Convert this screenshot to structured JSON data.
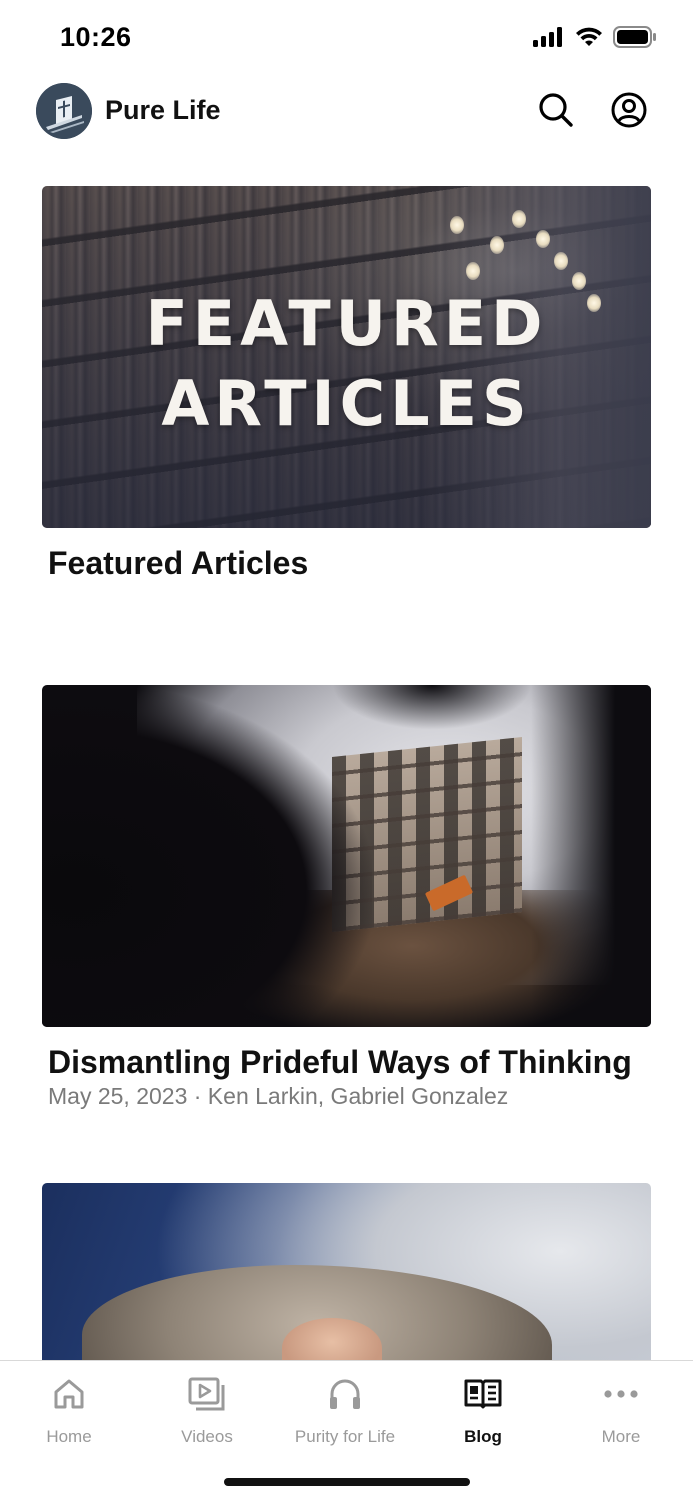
{
  "status_bar": {
    "time": "10:26",
    "icons": [
      "cellular-signal-icon",
      "wifi-icon",
      "battery-icon"
    ]
  },
  "header": {
    "app_name": "Pure Life",
    "logo_icon": "pure-life-logo",
    "actions": [
      {
        "icon": "search-icon"
      },
      {
        "icon": "account-icon"
      }
    ]
  },
  "feed": {
    "cards": [
      {
        "image_overlay_lines": [
          "FEATURED",
          "ARTICLES"
        ],
        "title": "Featured Articles",
        "meta": ""
      },
      {
        "title": "Dismantling Prideful Ways of Thinking",
        "meta": "May 25, 2023 · Ken Larkin, Gabriel Gonzalez"
      },
      {
        "title": "",
        "meta": ""
      }
    ]
  },
  "tab_bar": {
    "active": "Blog",
    "tabs": [
      {
        "label": "Home",
        "icon": "home-icon"
      },
      {
        "label": "Videos",
        "icon": "videos-icon"
      },
      {
        "label": "Purity for Life",
        "icon": "headphones-icon"
      },
      {
        "label": "Blog",
        "icon": "blog-book-icon"
      },
      {
        "label": "More",
        "icon": "more-dots-icon"
      }
    ]
  },
  "colors": {
    "text_primary": "#111111",
    "text_secondary": "#7a7a7a",
    "tab_inactive": "#9a9a9a",
    "logo_bg": "#3a4a5c"
  }
}
